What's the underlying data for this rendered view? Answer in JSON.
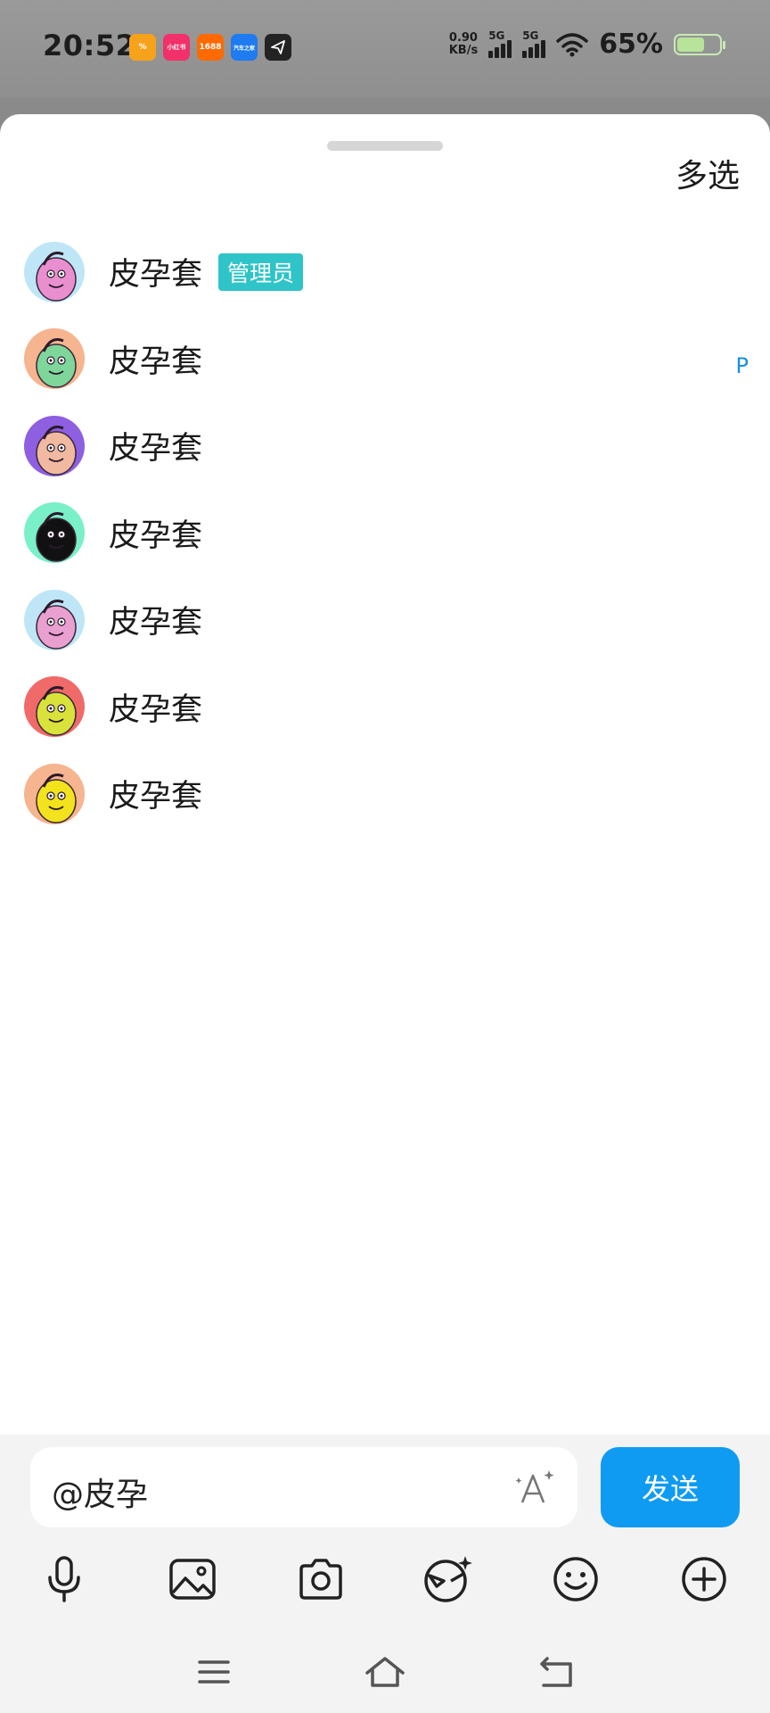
{
  "status_bar": {
    "time": "20:52",
    "net_speed_value": "0.90",
    "net_speed_unit": "KB/s",
    "sim1_label": "5G",
    "sim2_label": "5G",
    "battery_percent": "65%",
    "battery_level": 0.65,
    "apps": [
      {
        "icon": "discount-app-icon",
        "text": "%"
      },
      {
        "icon": "xiaohongshu-app-icon",
        "text": "小红书"
      },
      {
        "icon": "1688-app-icon",
        "text": "1688"
      },
      {
        "icon": "autohome-app-icon",
        "text": "汽车之家"
      },
      {
        "icon": "telegram-app-icon",
        "text": ""
      }
    ]
  },
  "sheet": {
    "multi_select_label": "多选",
    "index_letter": "P",
    "members": [
      {
        "name": "皮孕套",
        "badge": "管理员",
        "avatar_colors": [
          "#bfe6f7",
          "#e98fd0"
        ]
      },
      {
        "name": "皮孕套",
        "badge": "",
        "avatar_colors": [
          "#f6b48f",
          "#7fd69b"
        ]
      },
      {
        "name": "皮孕套",
        "badge": "",
        "avatar_colors": [
          "#8e5fe0",
          "#f0b9a0"
        ]
      },
      {
        "name": "皮孕套",
        "badge": "",
        "avatar_colors": [
          "#7af0c8",
          "#111111"
        ]
      },
      {
        "name": "皮孕套",
        "badge": "",
        "avatar_colors": [
          "#bfe6f7",
          "#e9a0d0"
        ]
      },
      {
        "name": "皮孕套",
        "badge": "",
        "avatar_colors": [
          "#f06a6a",
          "#d8e23a"
        ]
      },
      {
        "name": "皮孕套",
        "badge": "",
        "avatar_colors": [
          "#f6b48f",
          "#f2e31c"
        ]
      }
    ]
  },
  "input": {
    "value": "@皮孕",
    "send_label": "发送"
  },
  "colors": {
    "accent": "#0f9bf2",
    "badge": "#2ec4c8"
  },
  "toolbar_icons": [
    "microphone-icon",
    "image-icon",
    "camera-icon",
    "ai-face-icon",
    "emoji-icon",
    "plus-circle-icon"
  ],
  "nav_icons": [
    "menu-icon",
    "home-icon",
    "back-icon"
  ]
}
